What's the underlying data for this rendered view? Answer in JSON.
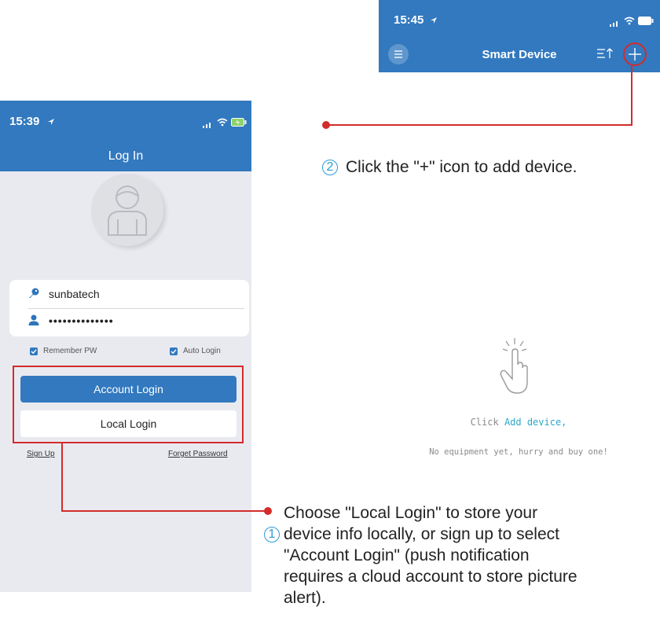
{
  "login_screen": {
    "status_time": "15:39",
    "title": "Log In",
    "username": "sunbatech",
    "password_mask": "••••••••••••••",
    "remember_label": "Remember PW",
    "auto_login_label": "Auto Login",
    "account_login_label": "Account Login",
    "local_login_label": "Local Login",
    "sign_up_label": "Sign Up",
    "forget_password_label": "Forget Password",
    "remember_checked": true,
    "auto_login_checked": true
  },
  "device_screen": {
    "status_time": "15:45",
    "title": "Smart Device",
    "empty_prefix": "Click ",
    "empty_link": "Add device,",
    "empty_secondary": "No equipment yet, hurry and buy one!"
  },
  "steps": [
    {
      "number": "1",
      "lines": [
        "Choose \"Local Login\"  to store your",
        "device info locally, or sign up to select",
        "\"Account Login\" (push notification",
        "requires a cloud account to store picture",
        "alert)."
      ]
    },
    {
      "number": "2",
      "text": "Click the \"+\" icon to add device."
    }
  ],
  "icons": {
    "location": "location-arrow-icon",
    "signal": "signal-icon",
    "wifi": "wifi-icon",
    "battery": "battery-icon",
    "menu": "list-menu-icon",
    "sort": "sort-icon",
    "plus": "plus-icon",
    "key": "key-icon",
    "user": "user-icon",
    "hand": "tap-hand-icon"
  },
  "colors": {
    "brand_blue": "#3279bf",
    "highlight_red": "#d42b2b",
    "step_blue": "#2f9bd7",
    "login_bg": "#e9eaf0",
    "accent_cyan": "#2ca8c8"
  }
}
